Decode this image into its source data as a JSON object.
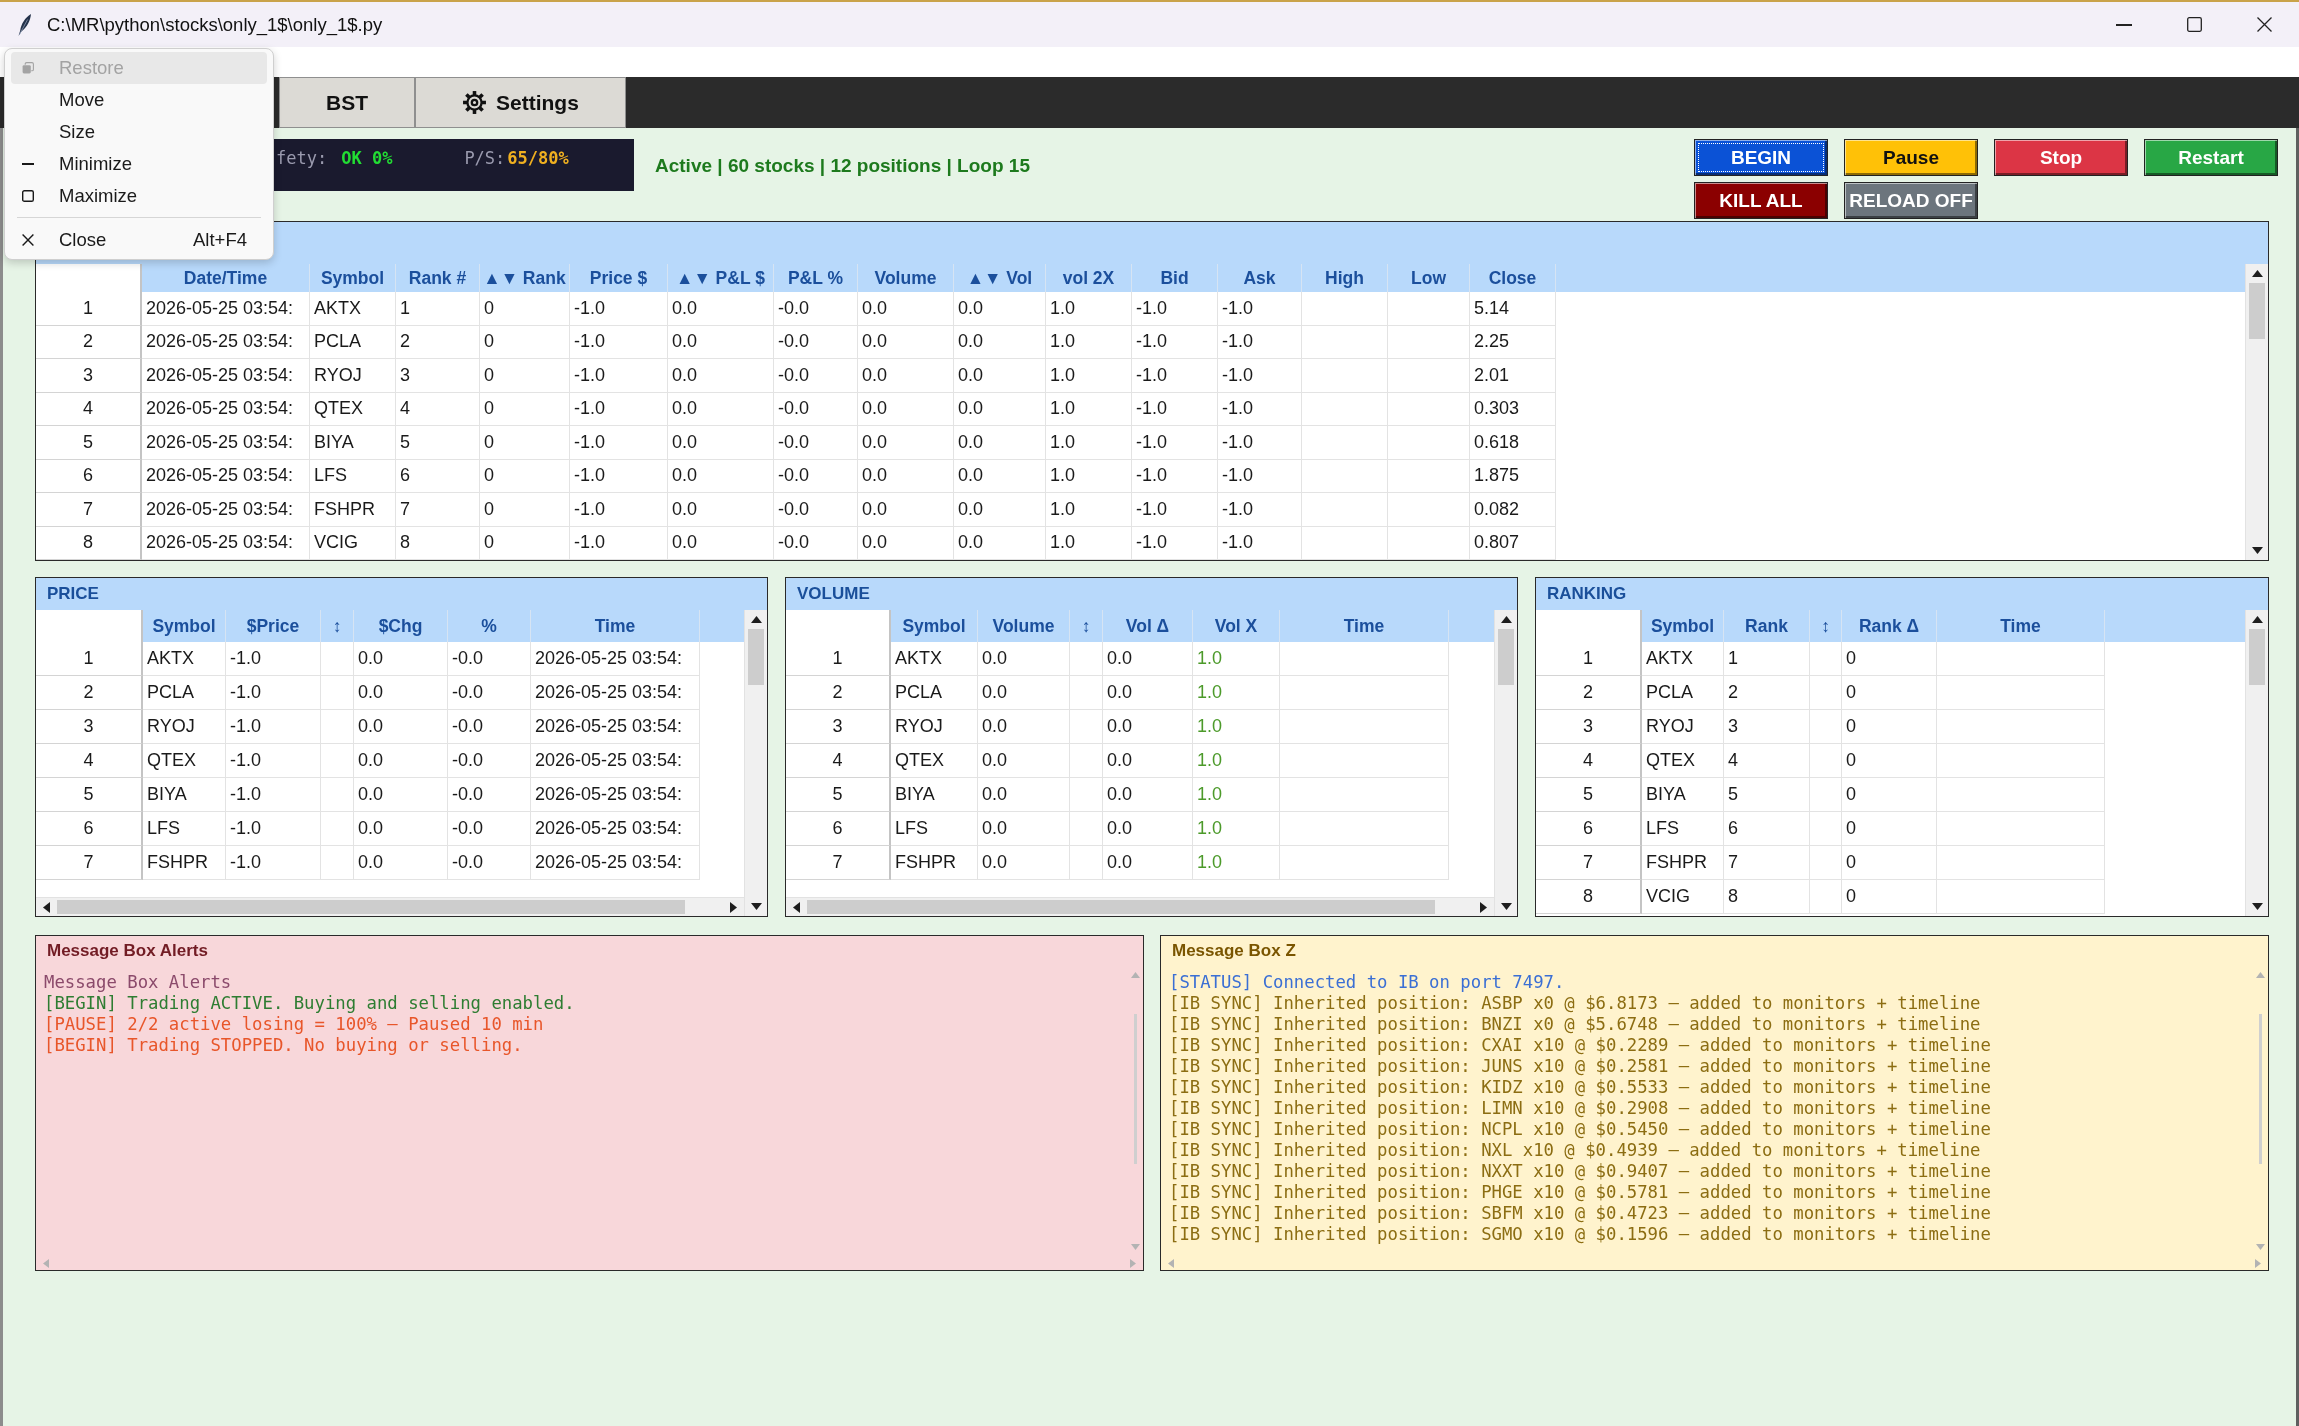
{
  "window": {
    "title": "C:\\MR\\python\\stocks\\only_1$\\only_1$.py"
  },
  "system_menu": {
    "sections": [
      {
        "items": [
          {
            "kind": "restore",
            "label": "Restore",
            "disabled": true,
            "highlighted": true
          },
          {
            "kind": "move",
            "label": "Move",
            "disabled": false,
            "highlighted": false
          },
          {
            "kind": "size",
            "label": "Size",
            "disabled": false,
            "highlighted": false
          },
          {
            "kind": "minimize",
            "label": "Minimize",
            "disabled": false,
            "highlighted": false
          },
          {
            "kind": "maximize",
            "label": "Maximize",
            "disabled": false,
            "highlighted": false
          }
        ]
      },
      {
        "items": [
          {
            "kind": "close",
            "label": "Close",
            "shortcut": "Alt+F4",
            "disabled": false,
            "highlighted": false
          }
        ]
      }
    ]
  },
  "tabs": [
    {
      "kind": "plain",
      "label": "BST",
      "selected": false
    },
    {
      "kind": "settings",
      "label": "Settings",
      "selected": false
    }
  ],
  "safety": {
    "label": "fety:",
    "value": "OK 0%",
    "ps_label": "P/S:",
    "ps_value": "65/80%"
  },
  "status": "Active | 60 stocks | 12 positions | Loop 15",
  "controls": {
    "rows": [
      {
        "buttons": [
          {
            "label": "BEGIN",
            "color": "#0b52d6",
            "focused": true
          },
          {
            "label": "Pause",
            "color": "#ffc107",
            "focused": false
          },
          {
            "label": "Stop",
            "color": "#dc3545",
            "focused": false
          },
          {
            "label": "Restart",
            "color": "#28a745",
            "focused": false
          }
        ]
      },
      {
        "buttons": [
          {
            "label": "KILL ALL",
            "color": "#8b0000",
            "focused": false
          },
          {
            "label": "RELOAD OFF",
            "color": "#6c757d",
            "focused": false
          }
        ]
      }
    ]
  },
  "main_table": {
    "columns": [
      {
        "label": "Date/Time"
      },
      {
        "label": "Symbol"
      },
      {
        "label": "Rank #"
      },
      {
        "label": "▲▼ Rank"
      },
      {
        "label": "Price $"
      },
      {
        "label": "▲▼ P&L $"
      },
      {
        "label": "P&L %"
      },
      {
        "label": "Volume"
      },
      {
        "label": "▲▼ Vol"
      },
      {
        "label": "vol 2X"
      },
      {
        "label": "Bid"
      },
      {
        "label": "Ask"
      },
      {
        "label": "High"
      },
      {
        "label": "Low"
      },
      {
        "label": "Close"
      }
    ],
    "rows": [
      {
        "number": "1",
        "cells": [
          "2026-05-25 03:54:",
          "AKTX",
          "1",
          "0",
          "-1.0",
          "0.0",
          "-0.0",
          "0.0",
          "0.0",
          "1.0",
          "-1.0",
          "-1.0",
          null,
          null,
          "5.14"
        ]
      },
      {
        "number": "2",
        "cells": [
          "2026-05-25 03:54:",
          "PCLA",
          "2",
          "0",
          "-1.0",
          "0.0",
          "-0.0",
          "0.0",
          "0.0",
          "1.0",
          "-1.0",
          "-1.0",
          null,
          null,
          "2.25"
        ]
      },
      {
        "number": "3",
        "cells": [
          "2026-05-25 03:54:",
          "RYOJ",
          "3",
          "0",
          "-1.0",
          "0.0",
          "-0.0",
          "0.0",
          "0.0",
          "1.0",
          "-1.0",
          "-1.0",
          null,
          null,
          "2.01"
        ]
      },
      {
        "number": "4",
        "cells": [
          "2026-05-25 03:54:",
          "QTEX",
          "4",
          "0",
          "-1.0",
          "0.0",
          "-0.0",
          "0.0",
          "0.0",
          "1.0",
          "-1.0",
          "-1.0",
          null,
          null,
          "0.303"
        ]
      },
      {
        "number": "5",
        "cells": [
          "2026-05-25 03:54:",
          "BIYA",
          "5",
          "0",
          "-1.0",
          "0.0",
          "-0.0",
          "0.0",
          "0.0",
          "1.0",
          "-1.0",
          "-1.0",
          null,
          null,
          "0.618"
        ]
      },
      {
        "number": "6",
        "cells": [
          "2026-05-25 03:54:",
          "LFS",
          "6",
          "0",
          "-1.0",
          "0.0",
          "-0.0",
          "0.0",
          "0.0",
          "1.0",
          "-1.0",
          "-1.0",
          null,
          null,
          "1.875"
        ]
      },
      {
        "number": "7",
        "cells": [
          "2026-05-25 03:54:",
          "FSHPR",
          "7",
          "0",
          "-1.0",
          "0.0",
          "-0.0",
          "0.0",
          "0.0",
          "1.0",
          "-1.0",
          "-1.0",
          null,
          null,
          "0.082"
        ]
      },
      {
        "number": "8",
        "cells": [
          "2026-05-25 03:54:",
          "VCIG",
          "8",
          "0",
          "-1.0",
          "0.0",
          "-0.0",
          "0.0",
          "0.0",
          "1.0",
          "-1.0",
          "-1.0",
          null,
          null,
          "0.807"
        ]
      }
    ]
  },
  "panels": [
    {
      "title": "PRICE",
      "horizontal_scrollbar": true,
      "columns": [
        {
          "label": "Symbol"
        },
        {
          "label": "$Price"
        },
        {
          "label": "↕"
        },
        {
          "label": "$Chg"
        },
        {
          "label": "%"
        },
        {
          "label": "Time"
        }
      ],
      "rows": [
        {
          "number": "1",
          "cells": [
            "AKTX",
            "-1.0",
            null,
            "0.0",
            "-0.0",
            "2026-05-25 03:54:"
          ]
        },
        {
          "number": "2",
          "cells": [
            "PCLA",
            "-1.0",
            null,
            "0.0",
            "-0.0",
            "2026-05-25 03:54:"
          ]
        },
        {
          "number": "3",
          "cells": [
            "RYOJ",
            "-1.0",
            null,
            "0.0",
            "-0.0",
            "2026-05-25 03:54:"
          ]
        },
        {
          "number": "4",
          "cells": [
            "QTEX",
            "-1.0",
            null,
            "0.0",
            "-0.0",
            "2026-05-25 03:54:"
          ]
        },
        {
          "number": "5",
          "cells": [
            "BIYA",
            "-1.0",
            null,
            "0.0",
            "-0.0",
            "2026-05-25 03:54:"
          ]
        },
        {
          "number": "6",
          "cells": [
            "LFS",
            "-1.0",
            null,
            "0.0",
            "-0.0",
            "2026-05-25 03:54:"
          ]
        },
        {
          "number": "7",
          "cells": [
            "FSHPR",
            "-1.0",
            null,
            "0.0",
            "-0.0",
            "2026-05-25 03:54:"
          ]
        }
      ]
    },
    {
      "title": "VOLUME",
      "horizontal_scrollbar": true,
      "columns": [
        {
          "label": "Symbol"
        },
        {
          "label": "Volume"
        },
        {
          "label": "↕"
        },
        {
          "label": "Vol Δ"
        },
        {
          "label": "Vol X",
          "color": "#4c9a2a"
        },
        {
          "label": "Time"
        }
      ],
      "rows": [
        {
          "number": "1",
          "cells": [
            "AKTX",
            "0.0",
            null,
            "0.0",
            "1.0"
          ]
        },
        {
          "number": "2",
          "cells": [
            "PCLA",
            "0.0",
            null,
            "0.0",
            "1.0"
          ]
        },
        {
          "number": "3",
          "cells": [
            "RYOJ",
            "0.0",
            null,
            "0.0",
            "1.0"
          ]
        },
        {
          "number": "4",
          "cells": [
            "QTEX",
            "0.0",
            null,
            "0.0",
            "1.0"
          ]
        },
        {
          "number": "5",
          "cells": [
            "BIYA",
            "0.0",
            null,
            "0.0",
            "1.0"
          ]
        },
        {
          "number": "6",
          "cells": [
            "LFS",
            "0.0",
            null,
            "0.0",
            "1.0"
          ]
        },
        {
          "number": "7",
          "cells": [
            "FSHPR",
            "0.0",
            null,
            "0.0",
            "1.0"
          ]
        }
      ]
    },
    {
      "title": "RANKING",
      "horizontal_scrollbar": false,
      "columns": [
        {
          "label": "Symbol"
        },
        {
          "label": "Rank"
        },
        {
          "label": "↕"
        },
        {
          "label": "Rank Δ"
        },
        {
          "label": "Time"
        }
      ],
      "rows": [
        {
          "number": "1",
          "cells": [
            "AKTX",
            "1",
            null,
            "0"
          ]
        },
        {
          "number": "2",
          "cells": [
            "PCLA",
            "2",
            null,
            "0"
          ]
        },
        {
          "number": "3",
          "cells": [
            "RYOJ",
            "3",
            null,
            "0"
          ]
        },
        {
          "number": "4",
          "cells": [
            "QTEX",
            "4",
            null,
            "0"
          ]
        },
        {
          "number": "5",
          "cells": [
            "BIYA",
            "5",
            null,
            "0"
          ]
        },
        {
          "number": "6",
          "cells": [
            "LFS",
            "6",
            null,
            "0"
          ]
        },
        {
          "number": "7",
          "cells": [
            "FSHPR",
            "7",
            null,
            "0"
          ]
        },
        {
          "number": "8",
          "cells": [
            "VCIG",
            "8",
            null,
            "0"
          ]
        }
      ]
    }
  ],
  "message_boxes": [
    {
      "kind": "alerts",
      "title": "Message Box Alerts",
      "lines": [
        {
          "text": "Message Box Alerts",
          "color": "#8b4a6b"
        },
        {
          "text": "[BEGIN] Trading ACTIVE. Buying and selling enabled.",
          "color": "#2e7d32"
        },
        {
          "text": "[PAUSE] 2/2 active losing = 100% — Paused 10 min",
          "color": "#e8562a"
        },
        {
          "text": "[BEGIN] Trading STOPPED. No buying or selling.",
          "color": "#e8562a"
        }
      ]
    },
    {
      "kind": "notices",
      "title": "Message Box Z",
      "lines": [
        {
          "text": "[STATUS] Connected to IB on port 7497.",
          "color": "#3b6fd4"
        },
        {
          "text": "[IB SYNC] Inherited position: ASBP x0 @ $6.8173 — added to monitors + timeline",
          "color": "#8c6d12"
        },
        {
          "text": "[IB SYNC] Inherited position: BNZI x0 @ $5.6748 — added to monitors + timeline",
          "color": "#8c6d12"
        },
        {
          "text": "[IB SYNC] Inherited position: CXAI x10 @ $0.2289 — added to monitors + timeline",
          "color": "#8c6d12"
        },
        {
          "text": "[IB SYNC] Inherited position: JUNS x10 @ $0.2581 — added to monitors + timeline",
          "color": "#8c6d12"
        },
        {
          "text": "[IB SYNC] Inherited position: KIDZ x10 @ $0.5533 — added to monitors + timeline",
          "color": "#8c6d12"
        },
        {
          "text": "[IB SYNC] Inherited position: LIMN x10 @ $0.2908 — added to monitors + timeline",
          "color": "#8c6d12"
        },
        {
          "text": "[IB SYNC] Inherited position: NCPL x10 @ $0.5450 — added to monitors + timeline",
          "color": "#8c6d12"
        },
        {
          "text": "[IB SYNC] Inherited position: NXL x10 @ $0.4939 — added to monitors + timeline",
          "color": "#8c6d12"
        },
        {
          "text": "[IB SYNC] Inherited position: NXXT x10 @ $0.9407 — added to monitors + timeline",
          "color": "#8c6d12"
        },
        {
          "text": "[IB SYNC] Inherited position: PHGE x10 @ $0.5781 — added to monitors + timeline",
          "color": "#8c6d12"
        },
        {
          "text": "[IB SYNC] Inherited position: SBFM x10 @ $0.4723 — added to monitors + timeline",
          "color": "#8c6d12"
        },
        {
          "text": "[IB SYNC] Inherited position: SGMO x10 @ $0.1596 — added to monitors + timeline",
          "color": "#8c6d12"
        }
      ]
    }
  ]
}
